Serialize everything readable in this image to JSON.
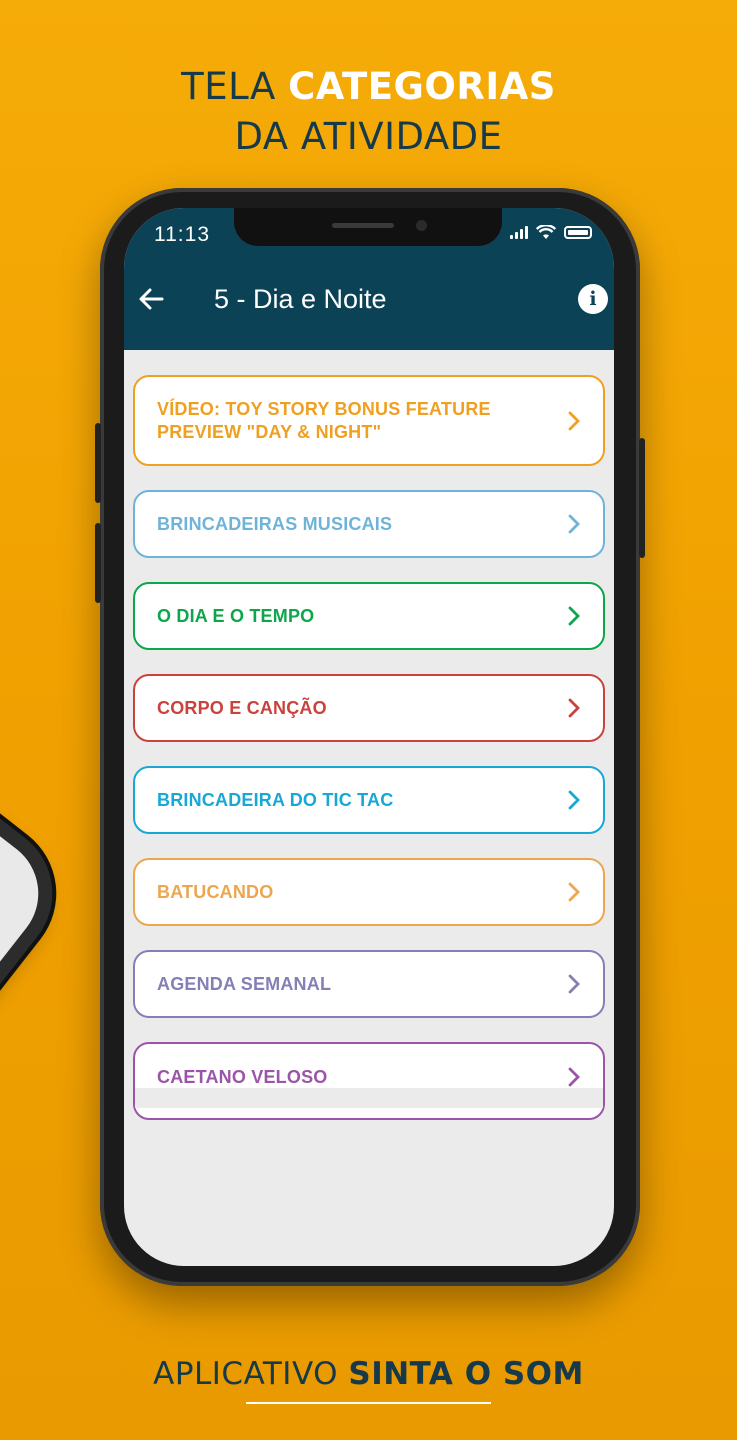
{
  "headline": {
    "line1_normal": "TELA ",
    "line1_strong": "CATEGORIAS",
    "line2": "DA ATIVIDADE"
  },
  "status_bar": {
    "time": "11:13"
  },
  "app_bar": {
    "title": "5 - Dia e Noite"
  },
  "categories": [
    {
      "label": "VÍDEO: TOY STORY BONUS FEATURE PREVIEW \"DAY & NIGHT\"",
      "color": "#f0a021"
    },
    {
      "label": "BRINCADEIRAS MUSICAIS",
      "color": "#6fb3d9"
    },
    {
      "label": "O DIA E O TEMPO",
      "color": "#0da64a"
    },
    {
      "label": "CORPO E CANÇÃO",
      "color": "#c9433c"
    },
    {
      "label": "BRINCADEIRA DO TIC TAC",
      "color": "#17a8d6"
    },
    {
      "label": "BATUCANDO",
      "color": "#eda64e"
    },
    {
      "label": "AGENDA SEMANAL",
      "color": "#8480b6"
    },
    {
      "label": "CAETANO VELOSO",
      "color": "#9b55a8"
    }
  ],
  "footer": {
    "normal": "APLICATIVO ",
    "strong": "SINTA O SOM"
  },
  "colors": {
    "background": "#f0a000",
    "appbar": "#0c4256",
    "headline": "#173a4a"
  }
}
